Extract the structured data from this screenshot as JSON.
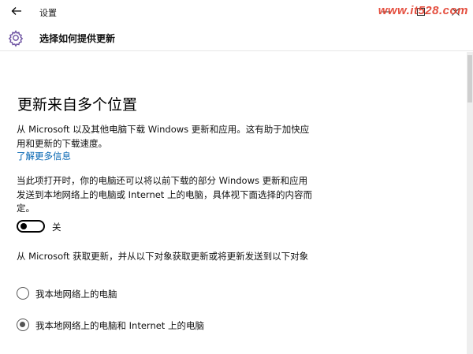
{
  "window": {
    "title": "设置",
    "watermark": "www.it528.com"
  },
  "header": {
    "title": "选择如何提供更新"
  },
  "main": {
    "heading": "更新来自多个位置",
    "intro": "从 Microsoft 以及其他电脑下载 Windows 更新和应用。这有助于加快应用和更新的下载速度。",
    "learn_more": "了解更多信息",
    "toggle_description": "当此项打开时，你的电脑还可以将以前下载的部分 Windows 更新和应用发送到本地网络上的电脑或 Internet 上的电脑，具体视下面选择的内容而定。",
    "toggle": {
      "label": "关",
      "on": false
    },
    "radio_description": "从 Microsoft 获取更新，并从以下对象获取更新或将更新发送到以下对象",
    "radio_options": [
      {
        "label": "我本地网络上的电脑",
        "selected": false
      },
      {
        "label": "我本地网络上的电脑和 Internet 上的电脑",
        "selected": true
      }
    ]
  },
  "colors": {
    "accent_link": "#0063b1",
    "watermark": "#e23b2a",
    "header_border": "#e6e6e6"
  },
  "icons": {
    "back": "arrow-left",
    "header": "gear",
    "minimize": "minus",
    "maximize": "square",
    "close": "x"
  }
}
